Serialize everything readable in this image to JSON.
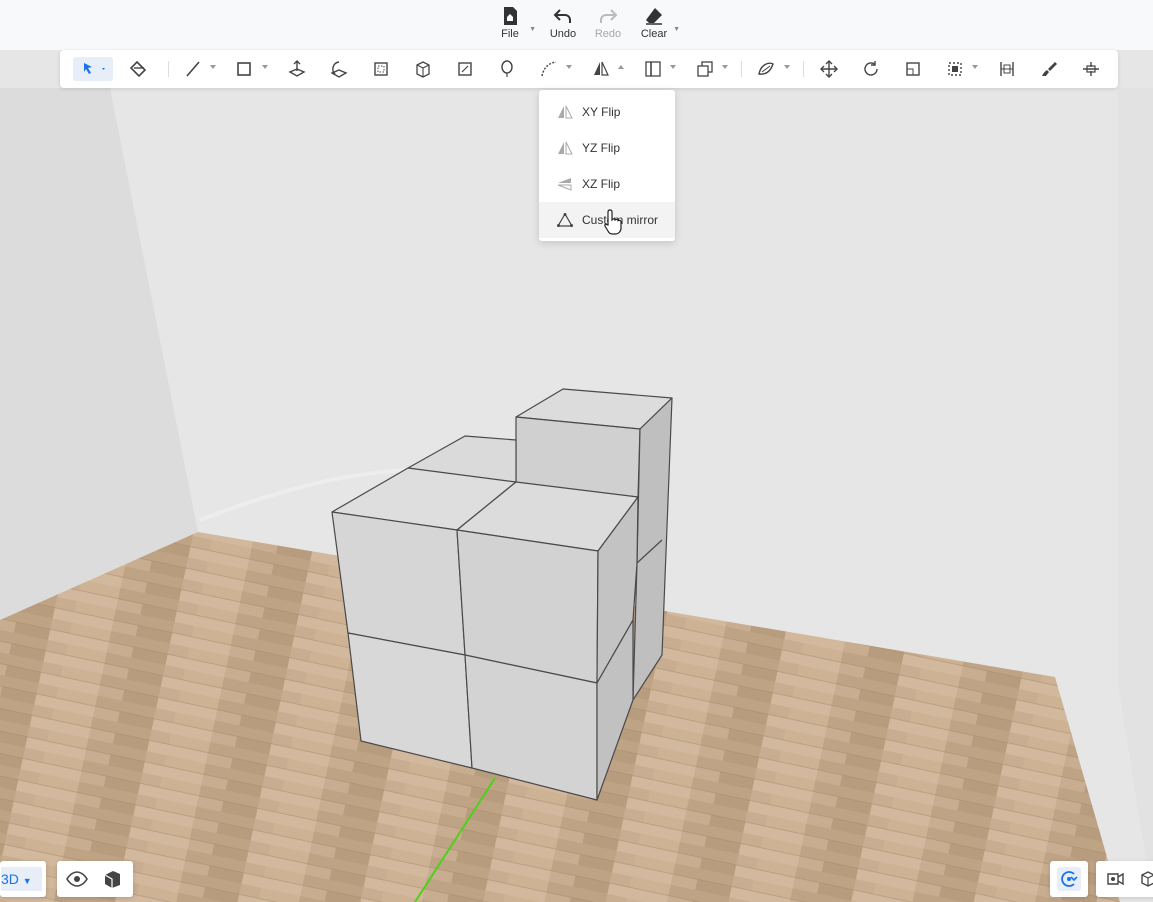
{
  "top_menu": {
    "file_label": "File",
    "undo_label": "Undo",
    "redo_label": "Redo",
    "clear_label": "Clear"
  },
  "toolbar": {
    "tools": [
      "select-tool",
      "paint-bucket-tool",
      "line-tool",
      "rectangle-tool",
      "push-pull-tool",
      "offset-tool",
      "select-box-tool",
      "3d-box-tool",
      "section-tool",
      "balloon-tool",
      "curve-tool",
      "flip-tool",
      "align-tool",
      "group-tool",
      "material-tool",
      "move-tool",
      "rotate-tool",
      "scale-tool",
      "selection-frame-tool",
      "dimension-tool",
      "brush-tool",
      "extend-tool"
    ]
  },
  "flip_menu": {
    "items": [
      {
        "label": "XY Flip",
        "icon": "xy-flip-icon"
      },
      {
        "label": "YZ Flip",
        "icon": "yz-flip-icon"
      },
      {
        "label": "XZ Flip",
        "icon": "xz-flip-icon"
      },
      {
        "label": "Custom mirror",
        "icon": "custom-mirror-icon"
      }
    ]
  },
  "bottom": {
    "view_mode_label": "3D"
  },
  "colors": {
    "accent": "#1a73e8",
    "floor": "#c4a889",
    "wall": "#e4e4e4",
    "cube": "#d4d4d4",
    "axis_green": "#4cd11a"
  }
}
